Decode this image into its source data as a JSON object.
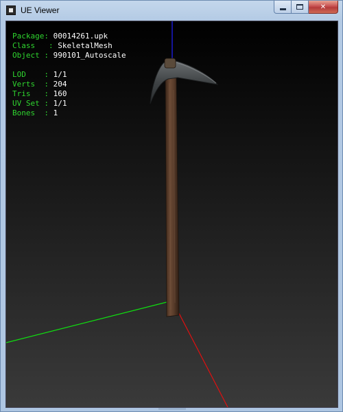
{
  "window": {
    "title": "UE Viewer",
    "icon": "app-icon",
    "buttons": {
      "minimize": "minimize-icon",
      "maximize": "maximize-icon",
      "close": "✕"
    }
  },
  "info": {
    "package": {
      "key": "Package",
      "sep": ":",
      "value": "00014261.upk"
    },
    "class": {
      "key": "Class",
      "sep": ":",
      "value": "SkeletalMesh"
    },
    "object": {
      "key": "Object",
      "sep": ":",
      "value": "990101_Autoscale"
    },
    "lod": {
      "key": "LOD",
      "sep": ":",
      "value": "1/1"
    },
    "verts": {
      "key": "Verts",
      "sep": ":",
      "value": "204"
    },
    "tris": {
      "key": "Tris",
      "sep": ":",
      "value": "160"
    },
    "uvset": {
      "key": "UV Set",
      "sep": ":",
      "value": "1/1"
    },
    "bones": {
      "key": "Bones",
      "sep": ":",
      "value": "1"
    }
  },
  "colors": {
    "label": "#2fd52f",
    "value": "#ffffff",
    "axis_x": "#e01010",
    "axis_y": "#10e010",
    "axis_z": "#2020ff"
  }
}
